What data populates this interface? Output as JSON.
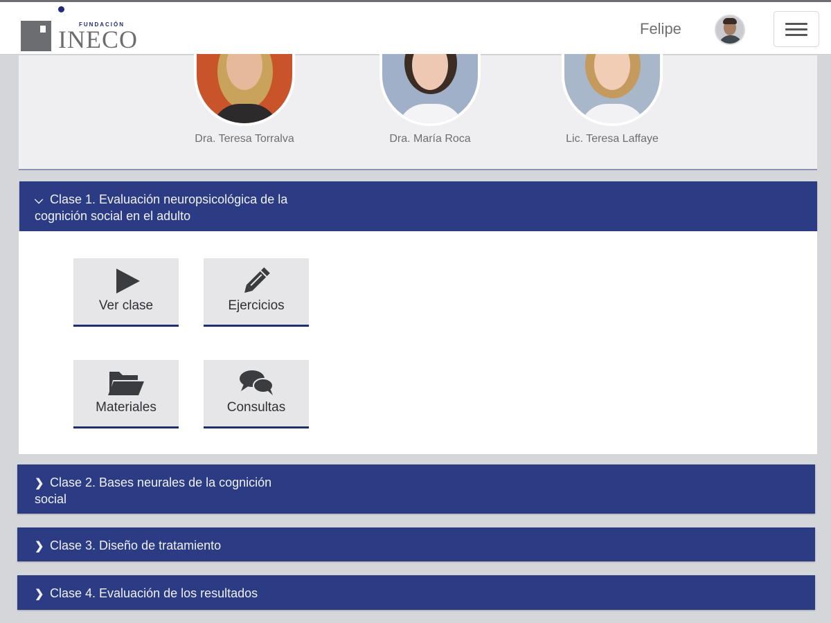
{
  "header": {
    "logo_small": "FUNDACIÓN",
    "logo_big": "INECO",
    "username": "Felipe",
    "avatar_icon": "user-avatar",
    "menu_icon": "hamburger-icon"
  },
  "instructors": [
    {
      "name": "Dra. Teresa Torralva"
    },
    {
      "name": "Dra. María Roca"
    },
    {
      "name": "Lic. Teresa Laffaye"
    }
  ],
  "classes": [
    {
      "label_line1": "Clase 1. Evaluación neuropsicológica de la",
      "label_line2": "cognición social en el adulto",
      "expanded": true,
      "chevron": "chevron-down-icon"
    },
    {
      "label_line1": "Clase 2. Bases neurales de la cognición",
      "label_line2": "social",
      "expanded": false,
      "chevron": "chevron-right-icon"
    },
    {
      "label_line1": "Clase 3. Diseño de tratamiento",
      "expanded": false,
      "chevron": "chevron-right-icon"
    },
    {
      "label_line1": "Clase 4. Evaluación de los resultados",
      "expanded": false,
      "chevron": "chevron-right-icon"
    }
  ],
  "actions": [
    {
      "label": "Ver clase",
      "icon": "play-icon"
    },
    {
      "label": "Ejercicios",
      "icon": "pencil-icon"
    },
    {
      "label": "Materiales",
      "icon": "folder-open-icon"
    },
    {
      "label": "Consultas",
      "icon": "chat-bubbles-icon"
    }
  ],
  "colors": {
    "accordion_header": "#2b3c84",
    "tile_background": "#e6e6e8",
    "tile_underline": "#1e2f6b",
    "page_background": "#d5d6da"
  }
}
